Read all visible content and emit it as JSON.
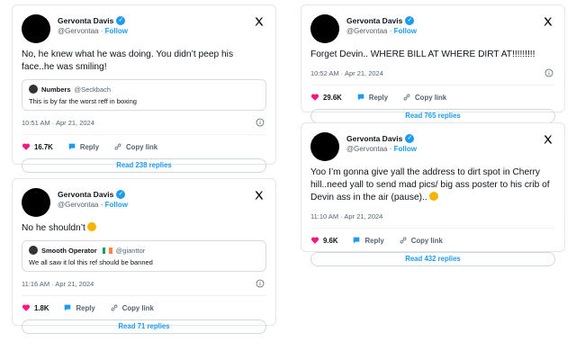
{
  "tweets": [
    {
      "name": "Gervonta Davis",
      "handle": "@Gervontaa",
      "follow": "Follow",
      "text": "No, he knew what he was doing. You didn’t peep his face..he was smiling!",
      "quote": {
        "name": "Numbers",
        "handle": "@Seckbach",
        "text": "This is by far the worst  reff in boxing"
      },
      "time": "10:51 AM · Apr 21, 2024",
      "likes": "16.7K",
      "reply": "Reply",
      "copy": "Copy link",
      "read": "Read 238 replies"
    },
    {
      "name": "Gervonta Davis",
      "handle": "@Gervontaa",
      "follow": "Follow",
      "text": "No he shouldn’t",
      "quote": {
        "name": "Smooth Operator",
        "handle": "@gianttor",
        "text": "We all saw it lol this ref should be banned"
      },
      "time": "11:16 AM · Apr 21, 2024",
      "likes": "1.8K",
      "reply": "Reply",
      "copy": "Copy link",
      "read": "Read 71 replies"
    },
    {
      "name": "Gervonta Davis",
      "handle": "@Gervontaa",
      "follow": "Follow",
      "text": "Forget Devin.. WHERE BILL AT WHERE DIRT AT!!!!!!!!!",
      "time": "10:52 AM · Apr 21, 2024",
      "likes": "29.6K",
      "reply": "Reply",
      "copy": "Copy link",
      "read": "Read 765 replies"
    },
    {
      "name": "Gervonta Davis",
      "handle": "@Gervontaa",
      "follow": "Follow",
      "text": "Yoo I’m gonna give yall the address to dirt spot in Cherry hill..need yall to send mad pics/ big ass poster to his crib of Devin ass in the air (pause)..",
      "time": "11:10 AM · Apr 21, 2024",
      "likes": "9.6K",
      "reply": "Reply",
      "copy": "Copy link",
      "read": "Read 432 replies"
    }
  ],
  "colors": {
    "accent": "#1d9bf0",
    "heart": "#f91880",
    "muted": "#536471"
  },
  "icons": [
    "verified-badge-icon",
    "x-logo-icon",
    "info-icon",
    "heart-icon",
    "reply-bubble-icon",
    "link-icon",
    "emoji-icon"
  ]
}
